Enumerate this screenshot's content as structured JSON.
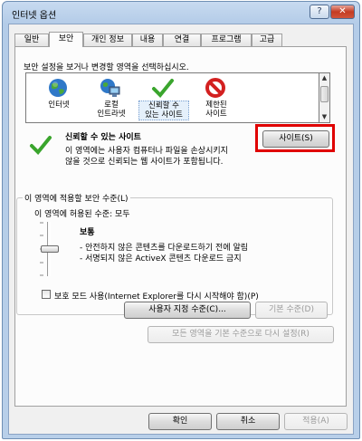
{
  "window": {
    "title": "인터넷 옵션",
    "help_label": "?",
    "close_label": "✕"
  },
  "tabs": [
    {
      "label": "일반"
    },
    {
      "label": "보안"
    },
    {
      "label": "개인 정보"
    },
    {
      "label": "내용"
    },
    {
      "label": "연결"
    },
    {
      "label": "프로그램"
    },
    {
      "label": "고급"
    }
  ],
  "security": {
    "instruction": "보안 설정을 보거나 변경할 영역을 선택하십시오.",
    "zones": [
      {
        "line1": "인터넷",
        "line2": "",
        "icon": "globe-icon"
      },
      {
        "line1": "로컬",
        "line2": "인트라넷",
        "icon": "intranet-icon"
      },
      {
        "line1": "신뢰할 수",
        "line2": "있는 사이트",
        "icon": "checkmark-icon"
      },
      {
        "line1": "제한된",
        "line2": "사이트",
        "icon": "restricted-icon"
      }
    ],
    "selected_zone": {
      "title": "신뢰할 수 있는 사이트",
      "desc1": "이 영역에는 사용자 컴퓨터나 파일을 손상시키지",
      "desc2": "않을 것으로 신뢰되는 웹 사이트가 포함됩니다."
    },
    "sites_button": "사이트(S)",
    "level_group": {
      "title": "이 영역에 적용할 보안 수준(L)",
      "allowed": "이 영역에 허용된 수준: 모두",
      "level_name": "보통",
      "bullet1": "- 안전하지 않은 콘텐츠를 다운로드하기 전에 알림",
      "bullet2": "- 서명되지 않은 ActiveX 콘텐츠 다운로드 금지",
      "protected_mode": "보호 모드 사용(Internet Explorer를 다시 시작해야 함)(P)",
      "custom_level_button": "사용자 지정 수준(C)...",
      "default_level_button": "기본 수준(D)"
    },
    "reset_all_button": "모든 영역을 기본 수준으로 다시 설정(R)"
  },
  "footer": {
    "ok": "확인",
    "cancel": "취소",
    "apply": "적용(A)"
  },
  "colors": {
    "highlight": "#e00000",
    "check_green": "#3aa52d",
    "restricted_red": "#d32020",
    "globe_blue": "#2f78c8"
  }
}
